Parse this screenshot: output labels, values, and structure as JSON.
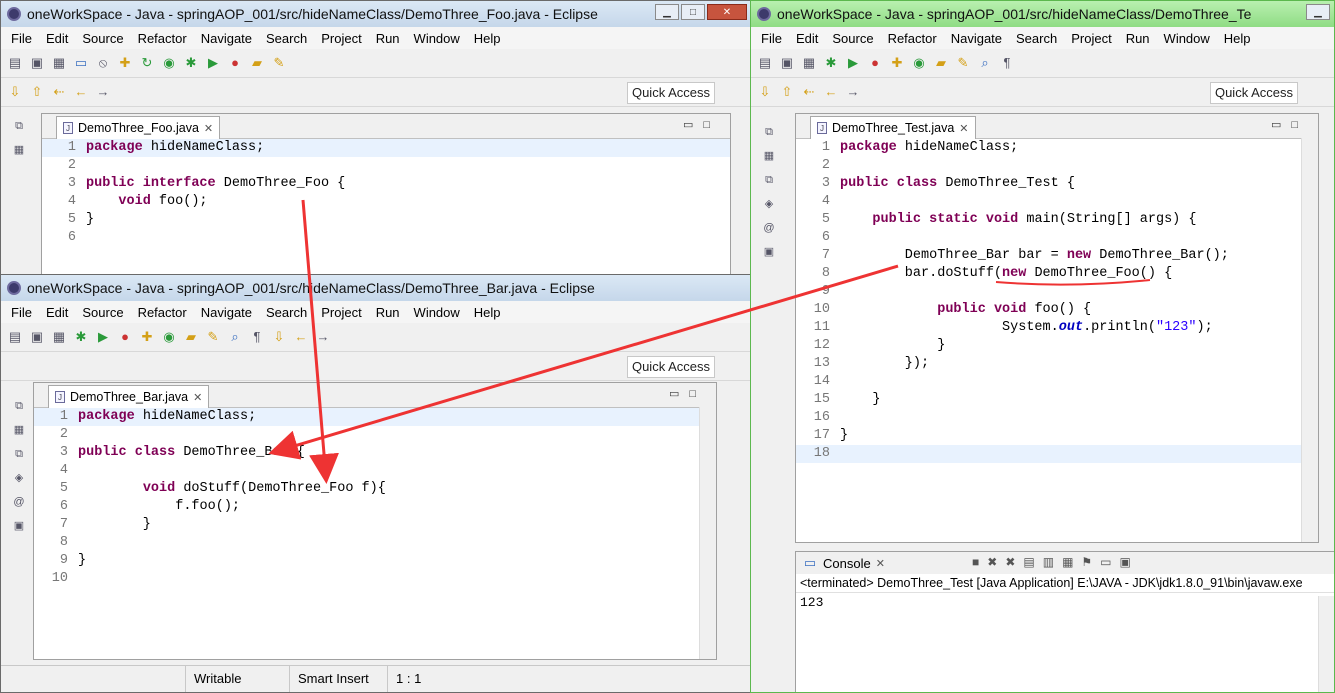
{
  "menu": [
    "File",
    "Edit",
    "Source",
    "Refactor",
    "Navigate",
    "Search",
    "Project",
    "Run",
    "Window",
    "Help"
  ],
  "quick_access": "Quick Access",
  "foo_window": {
    "title": "oneWorkSpace - Java - springAOP_001/src/hideNameClass/DemoThree_Foo.java - Eclipse",
    "tab": "DemoThree_Foo.java",
    "lines": [
      [
        {
          "t": "package",
          "k": "kw"
        },
        {
          "t": " hideNameClass;"
        }
      ],
      [],
      [
        {
          "t": "public",
          "k": "kw"
        },
        {
          "t": " "
        },
        {
          "t": "interface",
          "k": "kw"
        },
        {
          "t": " DemoThree_Foo {"
        }
      ],
      [
        {
          "t": "    "
        },
        {
          "t": "void",
          "k": "kw"
        },
        {
          "t": " foo();"
        }
      ],
      [
        {
          "t": "}"
        }
      ],
      []
    ]
  },
  "bar_window": {
    "title": "oneWorkSpace - Java - springAOP_001/src/hideNameClass/DemoThree_Bar.java - Eclipse",
    "tab": "DemoThree_Bar.java",
    "lines": [
      [
        {
          "t": "package",
          "k": "kw"
        },
        {
          "t": " hideNameClass;"
        }
      ],
      [],
      [
        {
          "t": "public",
          "k": "kw"
        },
        {
          "t": " "
        },
        {
          "t": "class",
          "k": "kw"
        },
        {
          "t": " DemoThree_Bar {"
        }
      ],
      [],
      [
        {
          "t": "        "
        },
        {
          "t": "void",
          "k": "kw"
        },
        {
          "t": " doStuff(DemoThree_Foo f){"
        }
      ],
      [
        {
          "t": "            f.foo();"
        }
      ],
      [
        {
          "t": "        }"
        }
      ],
      [],
      [
        {
          "t": "}"
        }
      ],
      []
    ],
    "status": {
      "writable": "Writable",
      "insert_mode": "Smart Insert",
      "position": "1 : 1"
    }
  },
  "test_window": {
    "title": "oneWorkSpace - Java - springAOP_001/src/hideNameClass/DemoThree_Te",
    "tab": "DemoThree_Test.java",
    "lines": [
      [
        {
          "t": "package",
          "k": "kw"
        },
        {
          "t": " hideNameClass;"
        }
      ],
      [],
      [
        {
          "t": "public",
          "k": "kw"
        },
        {
          "t": " "
        },
        {
          "t": "class",
          "k": "kw"
        },
        {
          "t": " DemoThree_Test {"
        }
      ],
      [],
      [
        {
          "t": "    "
        },
        {
          "t": "public",
          "k": "kw"
        },
        {
          "t": " "
        },
        {
          "t": "static",
          "k": "kw"
        },
        {
          "t": " "
        },
        {
          "t": "void",
          "k": "kw"
        },
        {
          "t": " main(String[] args) {"
        }
      ],
      [],
      [
        {
          "t": "        DemoThree_Bar bar = "
        },
        {
          "t": "new",
          "k": "kw"
        },
        {
          "t": " DemoThree_Bar();"
        }
      ],
      [
        {
          "t": "        bar.doStuff("
        },
        {
          "t": "new",
          "k": "kw"
        },
        {
          "t": " DemoThree_Foo() {"
        }
      ],
      [],
      [
        {
          "t": "            "
        },
        {
          "t": "public",
          "k": "kw"
        },
        {
          "t": " "
        },
        {
          "t": "void",
          "k": "kw"
        },
        {
          "t": " foo() {"
        }
      ],
      [
        {
          "t": "                    System."
        },
        {
          "t": "out",
          "k": "fld"
        },
        {
          "t": ".println("
        },
        {
          "t": "\"123\"",
          "k": "str"
        },
        {
          "t": ");"
        }
      ],
      [
        {
          "t": "            }"
        }
      ],
      [
        {
          "t": "        });"
        }
      ],
      [],
      [
        {
          "t": "    }"
        }
      ],
      [],
      [
        {
          "t": "}"
        }
      ],
      []
    ],
    "console": {
      "tab": "Console",
      "info": "<terminated> DemoThree_Test [Java Application] E:\\JAVA - JDK\\jdk1.8.0_91\\bin\\javaw.exe",
      "output": "123"
    }
  }
}
